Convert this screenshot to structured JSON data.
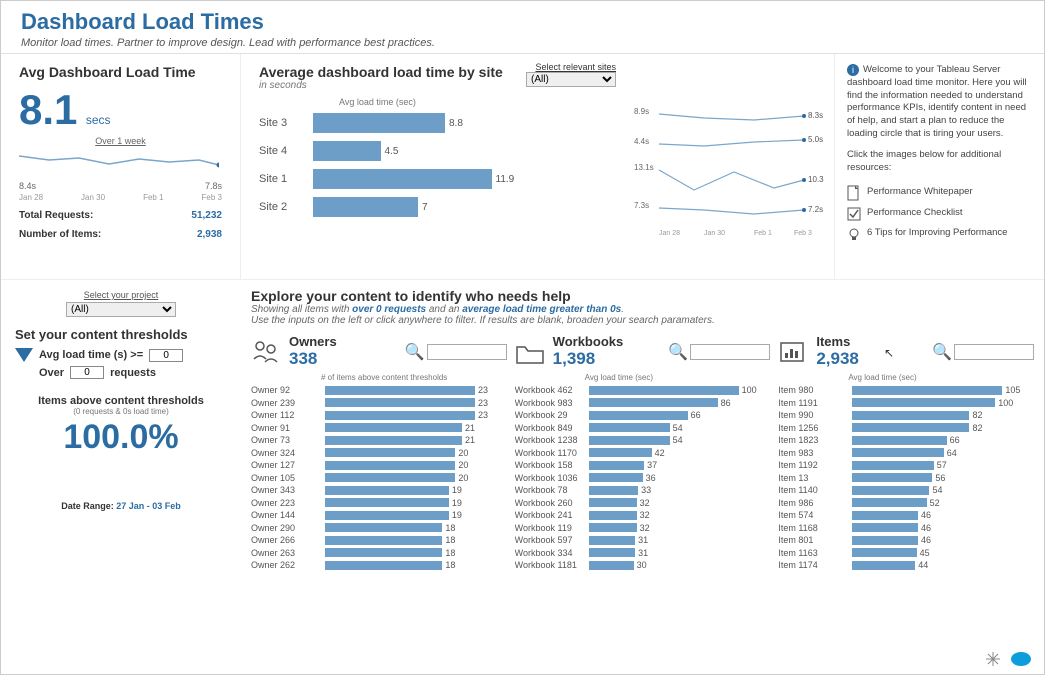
{
  "header": {
    "title": "Dashboard Load Times",
    "subtitle": "Monitor load times. Partner to improve design. Lead with performance best practices."
  },
  "kpi": {
    "title": "Avg Dashboard Load Time",
    "value": "8.1",
    "unit": "secs",
    "spark_label": "Over 1 week",
    "spark_start": "8.4s",
    "spark_end": "7.8s",
    "axis": [
      "Jan 28",
      "Jan 30",
      "Feb 1",
      "Feb 3"
    ],
    "total_requests_label": "Total Requests:",
    "total_requests": "51,232",
    "number_items_label": "Number of Items:",
    "number_items": "2,938"
  },
  "site_chart": {
    "title": "Average dashboard load time by site",
    "subtitle": "in seconds",
    "bar_label": "Avg load time (sec)",
    "select_label": "Select relevant sites",
    "select_value": "(All)",
    "rows": [
      {
        "name": "Site 3",
        "value": 8.8
      },
      {
        "name": "Site 4",
        "value": 4.5
      },
      {
        "name": "Site 1",
        "value": 11.9
      },
      {
        "name": "Site 2",
        "value": 7.0
      }
    ],
    "trend": {
      "axis": [
        "Jan 28",
        "Jan 30",
        "Feb 1",
        "Feb 3"
      ],
      "lines": [
        {
          "start": "8.9s",
          "end": "8.3s"
        },
        {
          "start": "4.4s",
          "end": "5.0s"
        },
        {
          "start": "13.1s",
          "end": "10.3s"
        },
        {
          "start": "7.3s",
          "end": "7.2s"
        }
      ]
    }
  },
  "info": {
    "text": "Welcome to your Tableau Server dashboard load time monitor. Here you will find the information needed to understand performance KPIs, identify content in need of help, and start a plan to reduce the loading circle that is tiring your users.",
    "text2": "Click the images below for additional resources:",
    "links": [
      "Performance Whitepaper",
      "Performance Checklist",
      "6 Tips for Improving Performance"
    ]
  },
  "filters": {
    "project_label": "Select your project",
    "project_value": "(All)",
    "thresholds_title": "Set your content thresholds",
    "avg_label": "Avg load time (s) >=",
    "avg_value": "0",
    "over_label": "Over",
    "over_value": "0",
    "over_suffix": "requests",
    "result_title": "Items above content thresholds",
    "result_sub": "(0 requests & 0s load time)",
    "result_pct": "100.0%",
    "daterange_label": "Date Range:",
    "daterange_value": "27 Jan - 03 Feb"
  },
  "explore": {
    "title": "Explore your content to identify who needs help",
    "desc_pre": "Showing all items with ",
    "desc_b1": "over 0 requests",
    "desc_mid": " and an ",
    "desc_b2": "average load time greater than 0s",
    "desc2": "Use the inputs on the left or click anywhere to filter. If results are blank, broaden your search paramaters."
  },
  "owners": {
    "label": "Owners",
    "count": "338",
    "hdr": "# of items above content thresholds",
    "rows": [
      {
        "n": "Owner 92",
        "v": 23
      },
      {
        "n": "Owner 239",
        "v": 23
      },
      {
        "n": "Owner 112",
        "v": 23
      },
      {
        "n": "Owner 91",
        "v": 21
      },
      {
        "n": "Owner 73",
        "v": 21
      },
      {
        "n": "Owner 324",
        "v": 20
      },
      {
        "n": "Owner 127",
        "v": 20
      },
      {
        "n": "Owner 105",
        "v": 20
      },
      {
        "n": "Owner 343",
        "v": 19
      },
      {
        "n": "Owner 223",
        "v": 19
      },
      {
        "n": "Owner 144",
        "v": 19
      },
      {
        "n": "Owner 290",
        "v": 18
      },
      {
        "n": "Owner 266",
        "v": 18
      },
      {
        "n": "Owner 263",
        "v": 18
      },
      {
        "n": "Owner 262",
        "v": 18
      }
    ],
    "max": 23
  },
  "workbooks": {
    "label": "Workbooks",
    "count": "1,398",
    "hdr": "Avg load time (sec)",
    "rows": [
      {
        "n": "Workbook 462",
        "v": 100
      },
      {
        "n": "Workbook 983",
        "v": 86
      },
      {
        "n": "Workbook 29",
        "v": 66
      },
      {
        "n": "Workbook 849",
        "v": 54
      },
      {
        "n": "Workbook 1238",
        "v": 54
      },
      {
        "n": "Workbook 1170",
        "v": 42
      },
      {
        "n": "Workbook 158",
        "v": 37
      },
      {
        "n": "Workbook 1036",
        "v": 36
      },
      {
        "n": "Workbook 78",
        "v": 33
      },
      {
        "n": "Workbook 260",
        "v": 32
      },
      {
        "n": "Workbook 241",
        "v": 32
      },
      {
        "n": "Workbook 119",
        "v": 32
      },
      {
        "n": "Workbook 597",
        "v": 31
      },
      {
        "n": "Workbook 334",
        "v": 31
      },
      {
        "n": "Workbook 1181",
        "v": 30
      }
    ],
    "max": 100
  },
  "items": {
    "label": "Items",
    "count": "2,938",
    "hdr": "Avg load time (sec)",
    "rows": [
      {
        "n": "Item 980",
        "v": 105
      },
      {
        "n": "Item 1191",
        "v": 100
      },
      {
        "n": "Item 990",
        "v": 82
      },
      {
        "n": "Item 1256",
        "v": 82
      },
      {
        "n": "Item 1823",
        "v": 66
      },
      {
        "n": "Item 983",
        "v": 64
      },
      {
        "n": "Item 1192",
        "v": 57
      },
      {
        "n": "Item 13",
        "v": 56
      },
      {
        "n": "Item 1140",
        "v": 54
      },
      {
        "n": "Item 986",
        "v": 52
      },
      {
        "n": "Item 574",
        "v": 46
      },
      {
        "n": "Item 1168",
        "v": 46
      },
      {
        "n": "Item 801",
        "v": 46
      },
      {
        "n": "Item 1163",
        "v": 45
      },
      {
        "n": "Item 1174",
        "v": 44
      }
    ],
    "max": 105
  },
  "chart_data": [
    {
      "type": "bar",
      "title": "Average dashboard load time by site",
      "xlabel": "Avg load time (sec)",
      "categories": [
        "Site 3",
        "Site 4",
        "Site 1",
        "Site 2"
      ],
      "values": [
        8.8,
        4.5,
        11.9,
        7.0
      ]
    },
    {
      "type": "line",
      "title": "Load time trend by site",
      "x": [
        "Jan 28",
        "Jan 30",
        "Feb 1",
        "Feb 3"
      ],
      "series": [
        {
          "name": "Site 3",
          "values": [
            8.9,
            8.4,
            8.2,
            8.3
          ]
        },
        {
          "name": "Site 4",
          "values": [
            4.4,
            4.3,
            4.5,
            5.0
          ]
        },
        {
          "name": "Site 1",
          "values": [
            13.1,
            9.5,
            12.0,
            10.3
          ]
        },
        {
          "name": "Site 2",
          "values": [
            7.3,
            7.2,
            6.9,
            7.2
          ]
        }
      ]
    },
    {
      "type": "line",
      "title": "Avg Dashboard Load Time sparkline",
      "x": [
        "Jan 28",
        "Jan 30",
        "Feb 1",
        "Feb 3"
      ],
      "values": [
        8.4,
        8.0,
        8.2,
        7.8
      ]
    },
    {
      "type": "bar",
      "title": "# of items above content thresholds (Owners)",
      "categories": [
        "Owner 92",
        "Owner 239",
        "Owner 112",
        "Owner 91",
        "Owner 73",
        "Owner 324",
        "Owner 127",
        "Owner 105",
        "Owner 343",
        "Owner 223",
        "Owner 144",
        "Owner 290",
        "Owner 266",
        "Owner 263",
        "Owner 262"
      ],
      "values": [
        23,
        23,
        23,
        21,
        21,
        20,
        20,
        20,
        19,
        19,
        19,
        18,
        18,
        18,
        18
      ]
    },
    {
      "type": "bar",
      "title": "Avg load time (sec) (Workbooks)",
      "categories": [
        "Workbook 462",
        "Workbook 983",
        "Workbook 29",
        "Workbook 849",
        "Workbook 1238",
        "Workbook 1170",
        "Workbook 158",
        "Workbook 1036",
        "Workbook 78",
        "Workbook 260",
        "Workbook 241",
        "Workbook 119",
        "Workbook 597",
        "Workbook 334",
        "Workbook 1181"
      ],
      "values": [
        100,
        86,
        66,
        54,
        54,
        42,
        37,
        36,
        33,
        32,
        32,
        32,
        31,
        31,
        30
      ]
    },
    {
      "type": "bar",
      "title": "Avg load time (sec) (Items)",
      "categories": [
        "Item 980",
        "Item 1191",
        "Item 990",
        "Item 1256",
        "Item 1823",
        "Item 983",
        "Item 1192",
        "Item 13",
        "Item 1140",
        "Item 986",
        "Item 574",
        "Item 1168",
        "Item 801",
        "Item 1163",
        "Item 1174"
      ],
      "values": [
        105,
        100,
        82,
        82,
        66,
        64,
        57,
        56,
        54,
        52,
        46,
        46,
        46,
        45,
        44
      ]
    }
  ]
}
